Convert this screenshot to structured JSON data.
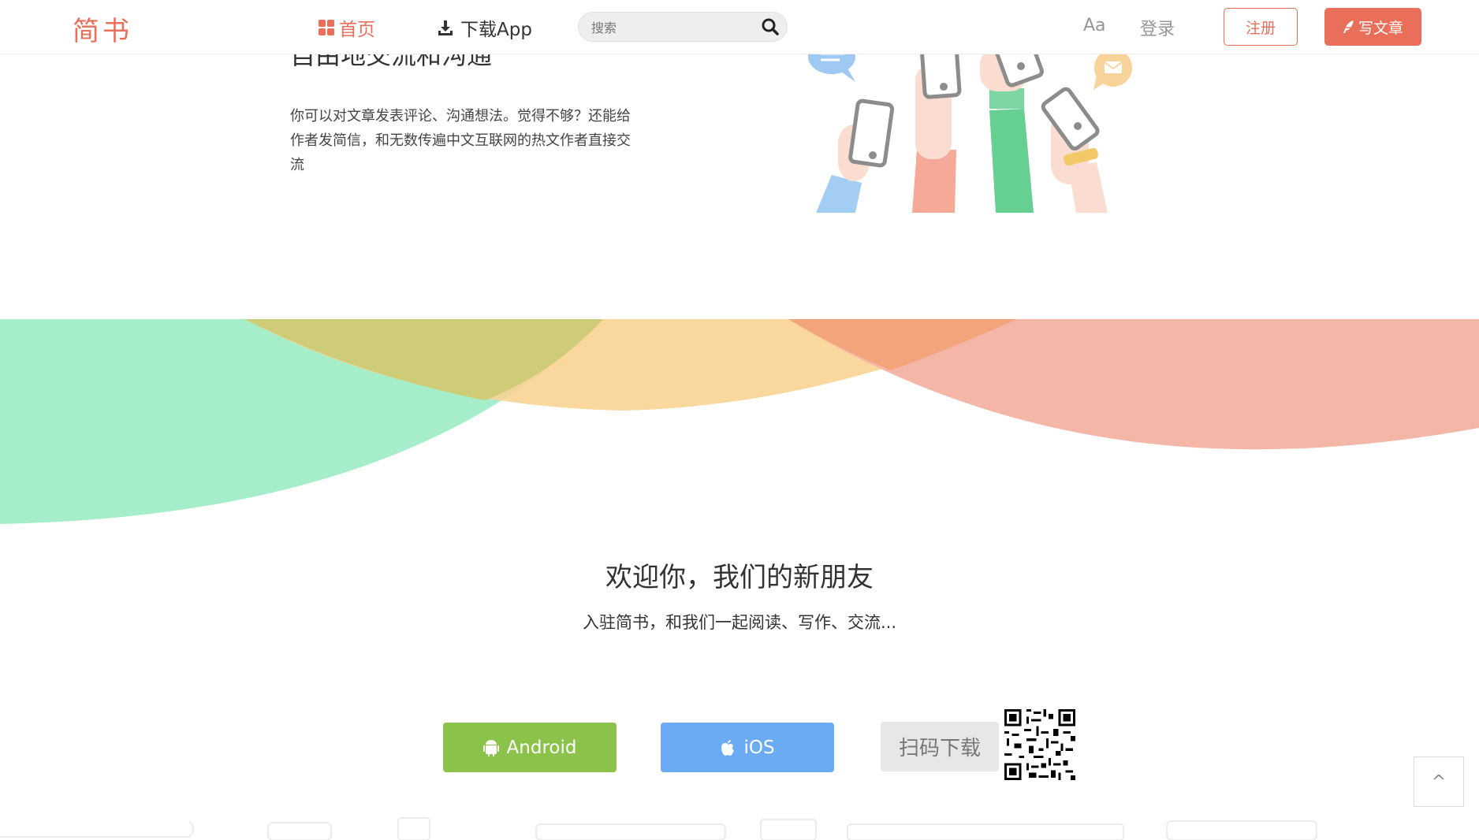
{
  "header": {
    "logo": "简书",
    "nav_home": "首页",
    "nav_download": "下载App",
    "search_placeholder": "搜索",
    "font_toggle": "Aa",
    "login": "登录",
    "register": "注册",
    "write": "写文章"
  },
  "feature": {
    "title": "自由地交流和沟通",
    "description": "你可以对文章发表评论、沟通想法。觉得不够？还能给作者发简信，和无数传遍中文互联网的热文作者直接交流"
  },
  "welcome": {
    "title": "欢迎你，我们的新朋友",
    "subtitle": "入驻简书，和我们一起阅读、写作、交流..."
  },
  "download": {
    "android": "Android",
    "ios": "iOS",
    "scan": "扫码下载"
  },
  "back_to_top": "^",
  "colors": {
    "brand": "#ea6f5a",
    "android": "#8bc34a",
    "ios": "#6aabf3",
    "arc_green": "#a6eec9",
    "arc_yellow": "#f9d495",
    "arc_pink": "#f3b6a7"
  }
}
